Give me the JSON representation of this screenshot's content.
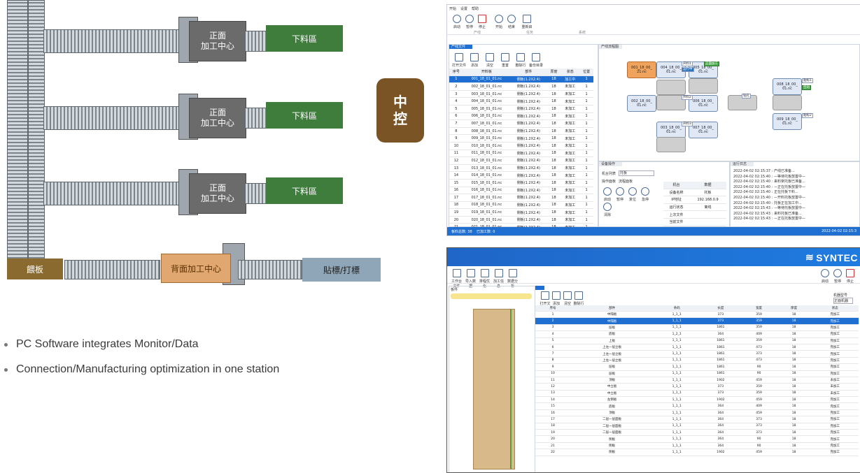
{
  "line_diagram": {
    "stations": [
      {
        "machine": "正面\n加工中心",
        "unload": "下料區"
      },
      {
        "machine": "正面\n加工中心",
        "unload": "下料區"
      },
      {
        "machine": "正面\n加工中心",
        "unload": "下料區"
      }
    ],
    "bottom_row": {
      "loading": "餵板",
      "machine": "背面加工中心",
      "labeling": "貼標/打標"
    },
    "central_control": "中\n控",
    "colors": {
      "machine": "#6b6b6b",
      "unload": "#3f7d3c",
      "loading": "#8a6a2e",
      "back_machine": "#e0a870",
      "labeling": "#8fa6b8",
      "central": "#7a5425"
    }
  },
  "bullets": [
    "PC Software integrates Monitor/Data",
    "Connection/Manufacturing optimization in one station"
  ],
  "monitor_app": {
    "menu": [
      "开始",
      "设置",
      "帮助"
    ],
    "toolbar": [
      {
        "label": "启动",
        "icon": "play-icon"
      },
      {
        "label": "暂停",
        "icon": "pause-icon"
      },
      {
        "label": "停止",
        "icon": "stop-icon"
      },
      {
        "label": "开始",
        "icon": "refresh-icon"
      },
      {
        "label": "结束",
        "icon": "power-icon"
      },
      {
        "label": "重新启",
        "icon": "file-icon"
      }
    ],
    "toolbar_groups": [
      "产线",
      "任务",
      "系统"
    ],
    "file_panel": {
      "title": "产线文件",
      "buttons": [
        "打开文件",
        "添加",
        "清空",
        "重置",
        "删除行",
        "备份目录"
      ],
      "columns": [
        "序号",
        "开料板",
        "部件",
        "厚度",
        "状态",
        "位置"
      ],
      "selected_row": 1,
      "rows": [
        [
          "1",
          "001_18_01_01.nc",
          "侧板(1.2X2.4)",
          "18",
          "加工中",
          "1"
        ],
        [
          "2",
          "002_18_01_01.nc",
          "侧板(1.2X2.4)",
          "18",
          "未加工",
          "1"
        ],
        [
          "3",
          "003_18_01_01.nc",
          "侧板(1.2X2.4)",
          "18",
          "未加工",
          "1"
        ],
        [
          "4",
          "004_18_01_01.nc",
          "侧板(1.2X2.4)",
          "18",
          "未加工",
          "1"
        ],
        [
          "5",
          "005_18_01_01.nc",
          "侧板(1.2X2.4)",
          "18",
          "未加工",
          "1"
        ],
        [
          "6",
          "006_18_01_01.nc",
          "侧板(1.2X2.4)",
          "18",
          "未加工",
          "1"
        ],
        [
          "7",
          "007_18_01_01.nc",
          "侧板(1.2X2.4)",
          "18",
          "未加工",
          "1"
        ],
        [
          "8",
          "008_18_01_01.nc",
          "侧板(1.2X2.4)",
          "18",
          "未加工",
          "1"
        ],
        [
          "9",
          "009_18_01_01.nc",
          "侧板(1.2X2.4)",
          "18",
          "未加工",
          "1"
        ],
        [
          "10",
          "010_18_01_01.nc",
          "侧板(1.2X2.4)",
          "18",
          "未加工",
          "1"
        ],
        [
          "11",
          "011_18_01_01.nc",
          "侧板(1.2X2.4)",
          "18",
          "未加工",
          "1"
        ],
        [
          "12",
          "012_18_01_01.nc",
          "侧板(1.2X2.4)",
          "18",
          "未加工",
          "1"
        ],
        [
          "13",
          "013_18_01_01.nc",
          "侧板(1.2X2.4)",
          "18",
          "未加工",
          "1"
        ],
        [
          "14",
          "014_18_01_01.nc",
          "侧板(1.2X2.4)",
          "18",
          "未加工",
          "1"
        ],
        [
          "15",
          "015_18_01_01.nc",
          "侧板(1.2X2.4)",
          "18",
          "未加工",
          "1"
        ],
        [
          "16",
          "016_18_01_01.nc",
          "侧板(1.2X2.4)",
          "18",
          "未加工",
          "1"
        ],
        [
          "17",
          "017_18_01_01.nc",
          "侧板(1.2X2.4)",
          "18",
          "未加工",
          "1"
        ],
        [
          "18",
          "018_18_01_01.nc",
          "侧板(1.2X2.4)",
          "18",
          "未加工",
          "1"
        ],
        [
          "19",
          "019_18_01_01.nc",
          "侧板(1.2X2.4)",
          "18",
          "未加工",
          "1"
        ],
        [
          "20",
          "020_18_01_01.nc",
          "侧板(1.2X2.4)",
          "18",
          "未加工",
          "1"
        ],
        [
          "21",
          "021_18_01_01.nc",
          "侧板(1.2X2.4)",
          "18",
          "未加工",
          "1"
        ]
      ]
    },
    "flow_panel": {
      "title": "产线流程图",
      "nodes": [
        {
          "text": "001_18_00_\n21.nc"
        },
        {
          "text": "004_18_00_\n01.nc"
        },
        {
          "text": "005_18_00_\n01.nc"
        },
        {
          "text": "002_18_00_\n01.nc"
        },
        {
          "text": "006_18_00_\n01.nc"
        },
        {
          "text": "003_18_00_\n01.nc"
        },
        {
          "text": "007_18_00_\n01.nc"
        },
        {
          "text": "008_18_00_\n01.nc"
        },
        {
          "text": "009_18_00_\n01.nc"
        }
      ],
      "tags": [
        "开料1",
        "开料2",
        "开料3",
        "正面加工",
        "钻孔",
        "贴标1",
        "贴标2",
        "运行中",
        "空闲"
      ]
    },
    "device_panel": {
      "title": "设备操作",
      "station_label": "机台列表",
      "station_value": "托板",
      "tabs": [
        "操作面板",
        "流程面板"
      ],
      "buttons": [
        "启动",
        "暂停",
        "复位",
        "急停",
        "清除"
      ],
      "info_rows": [
        [
          "机台",
          "数据"
        ],
        [
          "设备名称",
          "托板"
        ],
        [
          "IP地址",
          "192.168.0.9"
        ],
        [
          "运行状态",
          "离线"
        ],
        [
          "上次文件",
          ""
        ],
        [
          "当前文件",
          ""
        ]
      ]
    },
    "log_panel": {
      "title": "运行日志",
      "lines": [
        "2022-04-02 02:15:37 : 产线已准备...",
        "2022-04-02 02:15:40 : —等待托板放置中—",
        "2022-04-02 02:15:40 : 来料架托板已准备...",
        "2022-04-02 02:15:40 : —正在托板放置中—",
        "2022-04-02 02:15:40 : 正在托板下料...",
        "2022-04-02 02:15:40 : —开料托板放置中—",
        "2022-04-02 02:15:40 : 托板正在加工中...",
        "2022-04-02 02:15:43 : —等待托板放置中—",
        "2022-04-02 02:15:43 : 来料托板已准备...",
        "2022-04-02 02:15:43 : —正在托板放置中—"
      ]
    },
    "status": {
      "total_label": "板料总数:",
      "total": "38",
      "done_label": "已加工数:",
      "done": "0",
      "time": "2022-04-02 02:15:3"
    }
  },
  "syntec_app": {
    "brand": "SYNTEC",
    "toolbar": [
      "工作台文件",
      "导入数据",
      "排程优化",
      "加工信息",
      "数据分析"
    ],
    "right_buttons": [
      "启动",
      "暂停",
      "停止"
    ],
    "left_panel_title": "板件",
    "sub_toolbar": [
      "打开文件",
      "添加",
      "清空",
      "删除行"
    ],
    "right_select_label": "机器型号",
    "right_select_value": "正面机器",
    "columns": [
      "序号",
      "部件",
      "条码",
      "长度",
      "宽度",
      "厚度",
      "状态"
    ],
    "selected_row": 2,
    "rows": [
      [
        "1",
        "中隔板",
        "1_1_1",
        "373",
        "359",
        "18",
        "完加工"
      ],
      [
        "2",
        "中隔板",
        "1_1_1",
        "373",
        "359",
        "18",
        "完加工"
      ],
      [
        "3",
        "层板",
        "1_1_1",
        "1861",
        "359",
        "18",
        "完加工"
      ],
      [
        "4",
        "底板",
        "1_2_1",
        "364",
        "409",
        "18",
        "完加工"
      ],
      [
        "5",
        "上板",
        "1_1_1",
        "1861",
        "359",
        "18",
        "完加工"
      ],
      [
        "6",
        "上左一层立板",
        "1_1_1",
        "1861",
        "473",
        "18",
        "完加工"
      ],
      [
        "7",
        "上左一层立板",
        "1_1_1",
        "1861",
        "373",
        "18",
        "完加工"
      ],
      [
        "8",
        "上左一层立板",
        "1_1_1",
        "1861",
        "473",
        "18",
        "完加工"
      ],
      [
        "9",
        "层板",
        "1_1_1",
        "1861",
        "90",
        "18",
        "完加工"
      ],
      [
        "10",
        "层板",
        "1_1_1",
        "1861",
        "90",
        "18",
        "完加工"
      ],
      [
        "11",
        "顶板",
        "1_1_1",
        "1902",
        "459",
        "18",
        "未加工"
      ],
      [
        "12",
        "中立板",
        "1_1_1",
        "373",
        "359",
        "18",
        "未加工"
      ],
      [
        "13",
        "中立板",
        "1_1_1",
        "373",
        "359",
        "18",
        "未加工"
      ],
      [
        "14",
        "左侧板",
        "1_1_1",
        "1902",
        "459",
        "18",
        "完加工"
      ],
      [
        "15",
        "底板",
        "1_1_1",
        "364",
        "409",
        "18",
        "完加工"
      ],
      [
        "16",
        "顶板",
        "1_1_1",
        "364",
        "459",
        "18",
        "完加工"
      ],
      [
        "17",
        "二层一层面板",
        "1_1_1",
        "364",
        "373",
        "18",
        "完加工"
      ],
      [
        "18",
        "二层一层面板",
        "1_1_1",
        "364",
        "373",
        "18",
        "完加工"
      ],
      [
        "19",
        "二层一层面板",
        "1_1_1",
        "364",
        "373",
        "18",
        "完加工"
      ],
      [
        "20",
        "侧板",
        "1_1_1",
        "364",
        "90",
        "18",
        "完加工"
      ],
      [
        "21",
        "侧板",
        "1_1_1",
        "364",
        "90",
        "18",
        "完加工"
      ],
      [
        "22",
        "侧板",
        "1_1_1",
        "1902",
        "459",
        "18",
        "完加工"
      ]
    ]
  }
}
